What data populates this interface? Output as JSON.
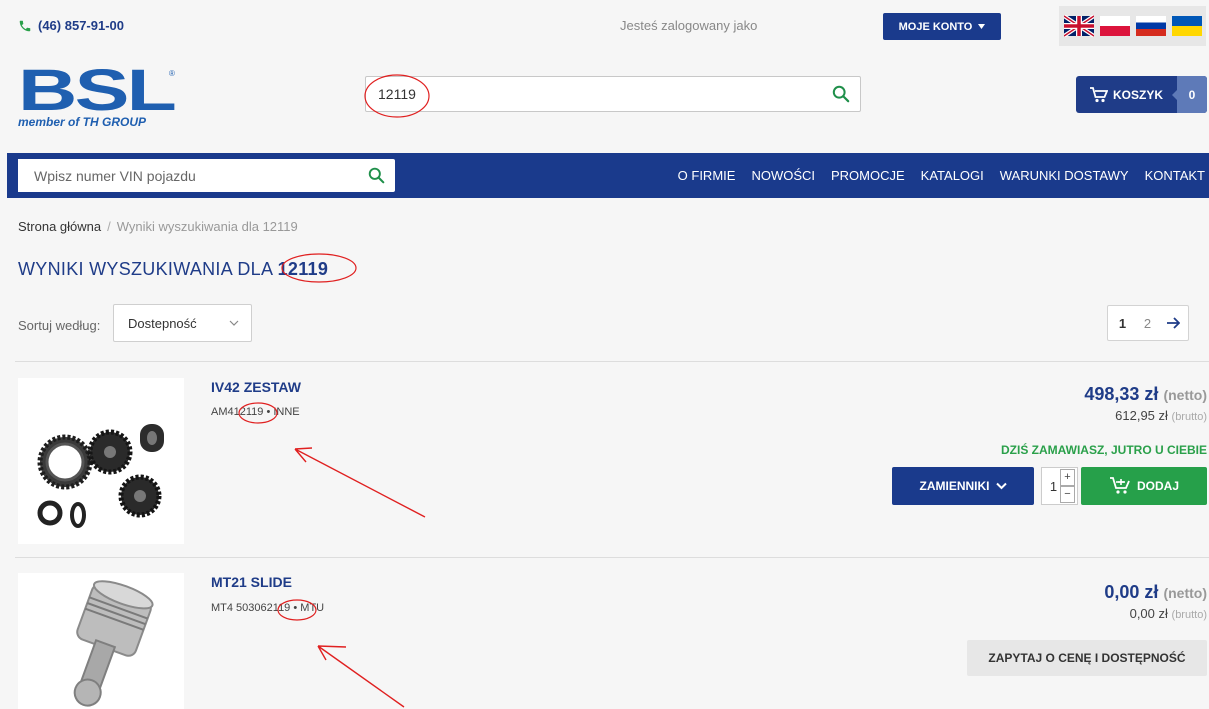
{
  "header": {
    "phone": "(46) 857-91-00",
    "logged_in_text": "Jesteś zalogowany jako",
    "account_label": "MOJE KONTO",
    "flags": [
      "gb-flag-icon",
      "pl-flag-icon",
      "ru-flag-icon",
      "ua-flag-icon"
    ]
  },
  "logo": {
    "text": "BSL",
    "subtitle": "member of TH GROUP"
  },
  "search": {
    "value": "12119"
  },
  "cart": {
    "label": "KOSZYK",
    "count": "0"
  },
  "nav": {
    "vin_placeholder": "Wpisz numer VIN pojazdu",
    "items": [
      "O FIRMIE",
      "NOWOŚCI",
      "PROMOCJE",
      "KATALOGI",
      "WARUNKI DOSTAWY",
      "KONTAKT"
    ]
  },
  "breadcrumb": {
    "home": "Strona główna",
    "separator": "/",
    "current": "Wyniki wyszukiwania dla 12119"
  },
  "results": {
    "title_prefix": "WYNIKI WYSZUKIWANIA DLA",
    "query": "12119"
  },
  "sort": {
    "label": "Sortuj według:",
    "selected": "Dostepność"
  },
  "pagination": {
    "pages": [
      "1",
      "2"
    ],
    "current": "1"
  },
  "products": [
    {
      "name": "IV42 ZESTAW",
      "code": "AM412119",
      "category": "INNE",
      "price_net": "498,33 zł",
      "net_label": "(netto)",
      "price_gross": "612,95 zł",
      "gross_label": "(brutto)",
      "availability": "DZIŚ ZAMAWIASZ, JUTRO U CIEBIE",
      "alternatives_label": "ZAMIENNIKI",
      "qty": "1",
      "add_label": "DODAJ"
    },
    {
      "name": "MT21 SLIDE",
      "code": "MT4 503062119",
      "category": "MTU",
      "price_net": "0,00 zł",
      "net_label": "(netto)",
      "price_gross": "0,00 zł",
      "gross_label": "(brutto)",
      "ask_label": "ZAPYTAJ O CENĘ I DOSTĘPNOŚĆ"
    }
  ],
  "colors": {
    "brand_blue": "#1a3a8c",
    "green": "#26a04a",
    "annotation_red": "#e02020"
  }
}
